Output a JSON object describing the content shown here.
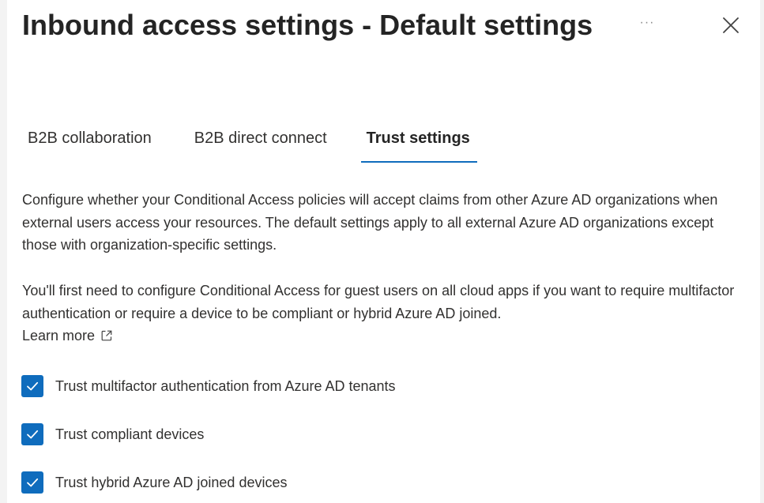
{
  "header": {
    "title": "Inbound access settings - Default settings",
    "more_label": "···"
  },
  "tabs": [
    {
      "label": "B2B collaboration",
      "active": false
    },
    {
      "label": "B2B direct connect",
      "active": false
    },
    {
      "label": "Trust settings",
      "active": true
    }
  ],
  "content": {
    "description": "Configure whether your Conditional Access policies will accept claims from other Azure AD organizations when external users access your resources. The default settings apply to all external Azure AD organizations except those with organization-specific settings.",
    "note": "You'll first need to configure Conditional Access for guest users on all cloud apps if you want to require multifactor authentication or require a device to be compliant or hybrid Azure AD joined.",
    "learn_more": "Learn more"
  },
  "options": [
    {
      "label": "Trust multifactor authentication from Azure AD tenants",
      "checked": true
    },
    {
      "label": "Trust compliant devices",
      "checked": true
    },
    {
      "label": "Trust hybrid Azure AD joined devices",
      "checked": true
    }
  ],
  "colors": {
    "accent": "#0f6cbd",
    "text": "#323130",
    "background": "#ffffff"
  }
}
